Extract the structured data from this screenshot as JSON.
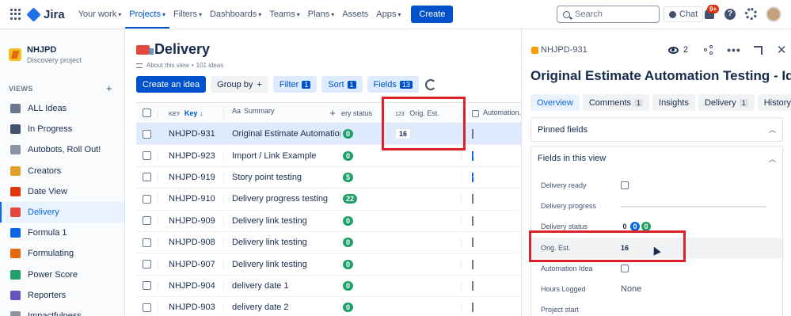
{
  "topnav": {
    "logo": "Jira",
    "items": [
      {
        "label": "Your work",
        "active": false
      },
      {
        "label": "Projects",
        "active": true
      },
      {
        "label": "Filters",
        "active": false
      },
      {
        "label": "Dashboards",
        "active": false
      },
      {
        "label": "Teams",
        "active": false
      },
      {
        "label": "Plans",
        "active": false
      },
      {
        "label": "Assets",
        "active": false
      },
      {
        "label": "Apps",
        "active": false
      }
    ],
    "create_label": "Create",
    "search_placeholder": "Search",
    "chat_label": "Chat",
    "notifications_badge": "9+"
  },
  "sidebar": {
    "project_name": "NHJPD",
    "project_type": "Discovery project",
    "views_label": "VIEWS",
    "views_add": "+",
    "items": [
      {
        "label": "ALL Ideas",
        "icon": "globe-icon",
        "color": "#6b778c"
      },
      {
        "label": "In Progress",
        "icon": "timeline-icon",
        "color": "#42526e"
      },
      {
        "label": "Autobots, Roll Out!",
        "icon": "robot-icon",
        "color": "#8993a4"
      },
      {
        "label": "Creators",
        "icon": "creator-icon",
        "color": "#e0a02a"
      },
      {
        "label": "Date View",
        "icon": "calendar-icon",
        "color": "#de350b"
      },
      {
        "label": "Delivery",
        "icon": "truck-icon",
        "color": "#e2483d",
        "active": true
      },
      {
        "label": "Formula 1",
        "icon": "racecar-icon",
        "color": "#0c66e4"
      },
      {
        "label": "Formulating",
        "icon": "abacus-icon",
        "color": "#e56910"
      },
      {
        "label": "Power Score",
        "icon": "battery-icon",
        "color": "#22a06b"
      },
      {
        "label": "Reporters",
        "icon": "pen-icon",
        "color": "#6554c0"
      },
      {
        "label": "Impactfulness",
        "icon": "impact-icon",
        "color": "#8993a4"
      }
    ]
  },
  "main": {
    "title": "Delivery",
    "about_link": "About this view",
    "separator": "•",
    "ideas_count": "101 ideas",
    "toolbar": {
      "create_idea": "Create an idea",
      "group_by": "Group by",
      "group_by_plus": "+",
      "filter": "Filter",
      "filter_count": "1",
      "sort": "Sort",
      "sort_count": "1",
      "fields": "Fields",
      "fields_count": "13"
    },
    "table": {
      "headers": {
        "key": "Key",
        "summary": "Summary",
        "delivery_status": "ery status",
        "orig_est": "Orig. Est.",
        "automation": "Automation..."
      },
      "rows": [
        {
          "key": "NHJPD-931",
          "summary": "Original Estimate Automation Testing",
          "status": "0",
          "orig_est": "16",
          "auto": false,
          "selected": true
        },
        {
          "key": "NHJPD-923",
          "summary": "Import / Link Example",
          "status": "0",
          "orig_est": "",
          "auto": true
        },
        {
          "key": "NHJPD-919",
          "summary": "Story point testing",
          "status": "5",
          "orig_est": "",
          "auto": true
        },
        {
          "key": "NHJPD-910",
          "summary": "Delivery progress testing",
          "status": "22",
          "orig_est": "",
          "auto": false
        },
        {
          "key": "NHJPD-909",
          "summary": "Delivery link testing",
          "status": "0",
          "orig_est": "",
          "auto": false
        },
        {
          "key": "NHJPD-908",
          "summary": "Delivery link testing",
          "status": "0",
          "orig_est": "",
          "auto": false
        },
        {
          "key": "NHJPD-907",
          "summary": "Delivery link testing",
          "status": "0",
          "orig_est": "",
          "auto": false
        },
        {
          "key": "NHJPD-904",
          "summary": "delivery date 1",
          "status": "0",
          "orig_est": "",
          "auto": false
        },
        {
          "key": "NHJPD-903",
          "summary": "delivery date 2",
          "status": "0",
          "orig_est": "",
          "auto": false
        }
      ]
    }
  },
  "detail": {
    "key": "NHJPD-931",
    "watchers": "2",
    "title": "Original Estimate Automation Testing - Idea",
    "tabs": [
      {
        "label": "Overview",
        "active": true,
        "count": ""
      },
      {
        "label": "Comments",
        "count": "1"
      },
      {
        "label": "Insights",
        "count": ""
      },
      {
        "label": "Delivery",
        "count": "1"
      },
      {
        "label": "History",
        "count": ""
      }
    ],
    "pinned_fields": "Pinned fields",
    "fields_in_view": "Fields in this view",
    "fields": {
      "delivery_ready": "Delivery ready",
      "delivery_progress": "Delivery progress",
      "delivery_status": "Delivery status",
      "status_values": [
        "0",
        "0",
        "0"
      ],
      "orig_est": "Orig. Est.",
      "orig_est_value": "16",
      "automation_idea": "Automation Idea",
      "hours_logged": "Hours Logged",
      "hours_logged_value": "None",
      "project_start": "Project start"
    }
  }
}
